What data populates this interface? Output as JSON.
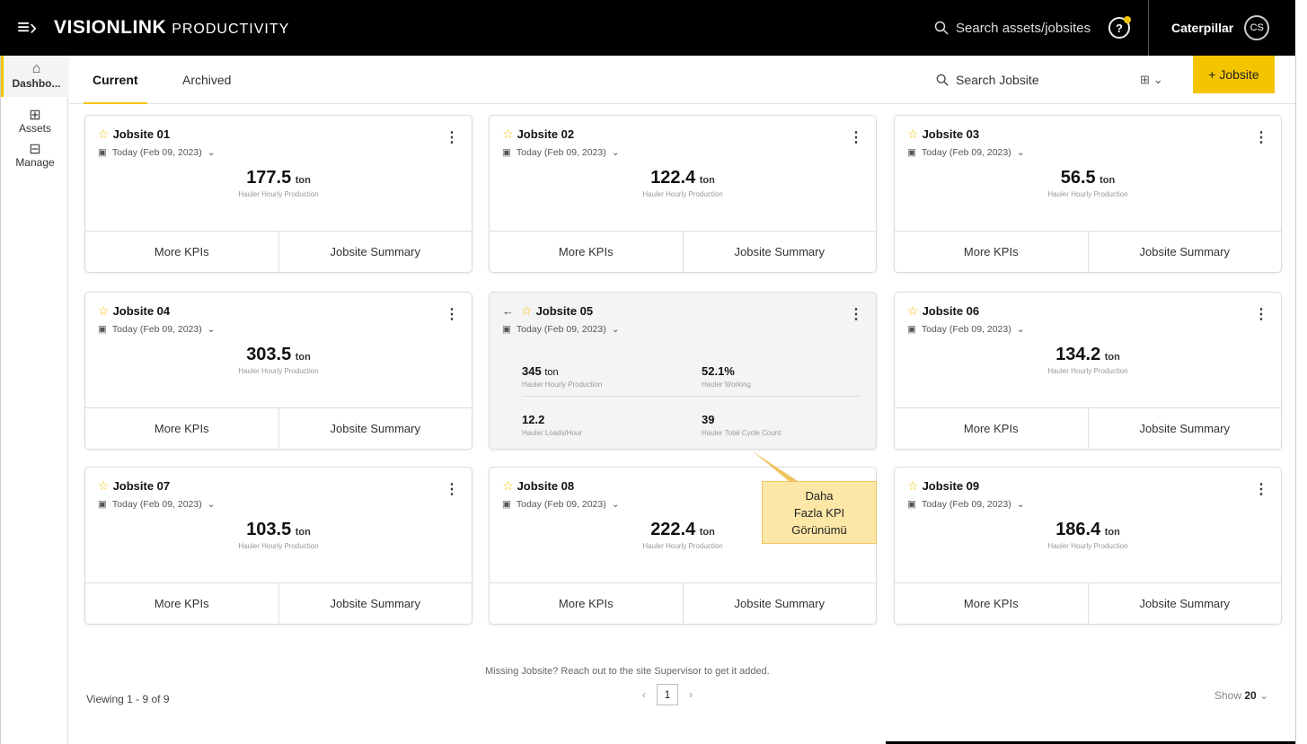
{
  "topbar": {
    "brand": "VISIONLINK",
    "product": "PRODUCTIVITY",
    "search_label": "Search assets/jobsites",
    "org_name": "Caterpillar",
    "avatar_initials": "CS"
  },
  "sidenav": {
    "items": [
      {
        "label": "Dashbo...",
        "icon": "home-icon"
      },
      {
        "label": "Assets",
        "icon": "assets-icon"
      },
      {
        "label": "Manage",
        "icon": "manage-icon"
      }
    ]
  },
  "subheader": {
    "tabs": [
      "Current",
      "Archived"
    ],
    "search_placeholder": "Search Jobsite",
    "add_button": "+ Jobsite"
  },
  "card_labels": {
    "more_kpis": "More KPIs",
    "summary": "Jobsite Summary",
    "kpi_label": "Hauler Hourly Production",
    "unit": "ton",
    "date": "Today (Feb 09, 2023)"
  },
  "cards": [
    {
      "name": "Jobsite 01",
      "value": "177.5"
    },
    {
      "name": "Jobsite 02",
      "value": "122.4"
    },
    {
      "name": "Jobsite 03",
      "value": "56.5"
    },
    {
      "name": "Jobsite 04",
      "value": "303.5"
    },
    {
      "name": "Jobsite 05",
      "value": ""
    },
    {
      "name": "Jobsite 06",
      "value": "134.2"
    },
    {
      "name": "Jobsite 07",
      "value": "103.5"
    },
    {
      "name": "Jobsite 08",
      "value": "222.4"
    },
    {
      "name": "Jobsite 09",
      "value": "186.4"
    }
  ],
  "expanded_kpis": [
    {
      "value": "345",
      "unit": "ton",
      "label": "Hauler Hourly Production"
    },
    {
      "value": "52.1%",
      "unit": "",
      "label": "Hauler Working"
    },
    {
      "value": "12.2",
      "unit": "",
      "label": "Hauler Loads/Hour"
    },
    {
      "value": "39",
      "unit": "",
      "label": "Hauler Total Cycle Count"
    }
  ],
  "callout": {
    "line1": "Daha",
    "line2": "Fazla KPI",
    "line3": "Görünümü"
  },
  "footer": {
    "missing": "Missing Jobsite? Reach out to the site Supervisor to get it added.",
    "viewing": "Viewing 1 - 9 of 9",
    "page": "1",
    "show_label": "Show",
    "show_value": "20"
  }
}
